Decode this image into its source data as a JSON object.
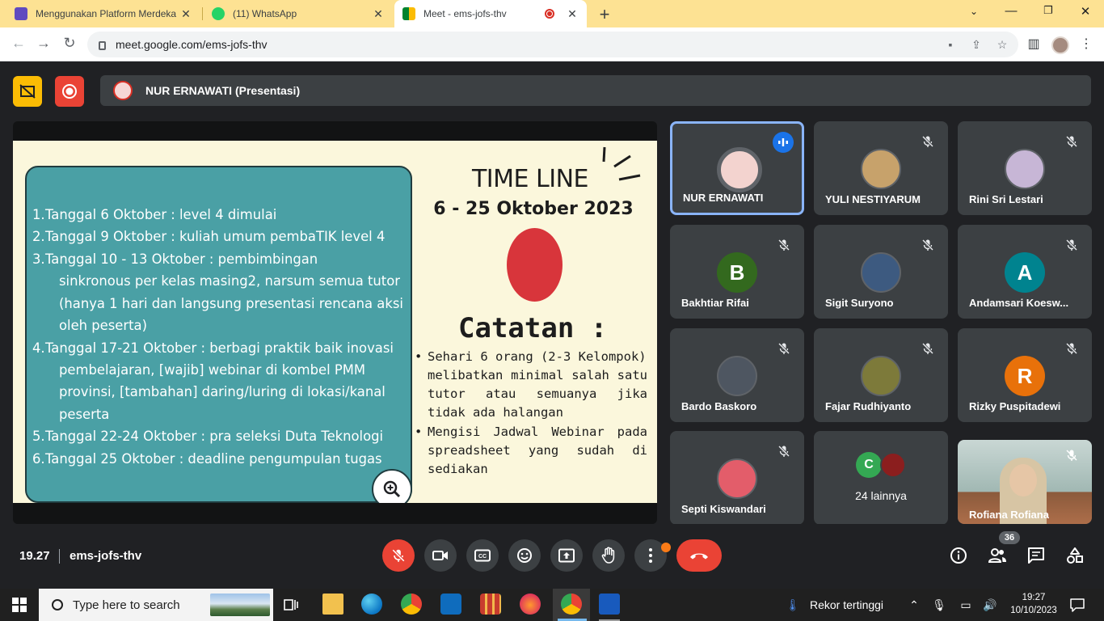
{
  "browser": {
    "tabs": [
      {
        "title": "Menggunakan Platform Merdeka",
        "favicon_color": "#5f4bbf"
      },
      {
        "title": "(11) WhatsApp",
        "favicon_color": "#25d366"
      },
      {
        "title": "Meet - ems-jofs-thv",
        "favicon_color": "#00897b"
      }
    ],
    "url": "meet.google.com/ems-jofs-thv"
  },
  "meet": {
    "presenter_label": "NUR ERNAWATI (Presentasi)",
    "slide": {
      "timeline": [
        {
          "num": "1.",
          "text": "Tanggal 6 Oktober  : level 4 dimulai"
        },
        {
          "num": "2.",
          "text": "Tanggal 9 Oktober : kuliah umum pembaTIK level 4"
        },
        {
          "num": "3.",
          "text": " Tanggal 10 - 13 Oktober  : pembimbingan"
        },
        {
          "num": "",
          "text": "sinkronous per kelas masing2, narsum semua tutor"
        },
        {
          "num": "",
          "text": "(hanya 1 hari dan langsung presentasi rencana aksi"
        },
        {
          "num": "",
          "text": "oleh peserta)"
        },
        {
          "num": "4.",
          "text": "Tanggal 17-21 Oktober  : berbagi praktik baik inovasi"
        },
        {
          "num": "",
          "text": "pembelajaran, [wajib] webinar di kombel PMM"
        },
        {
          "num": "",
          "text": "provinsi, [tambahan] daring/luring di lokasi/kanal"
        },
        {
          "num": "",
          "text": "peserta"
        },
        {
          "num": "5.",
          "text": "Tanggal 22-24 Oktober  : pra seleksi Duta Teknologi"
        },
        {
          "num": "6.",
          "text": "Tanggal 25 Oktober  : deadline pengumpulan tugas"
        }
      ],
      "title": "TIME LINE",
      "date_range": "6 - 25 Oktober 2023",
      "notes_heading": "Catatan :",
      "notes": [
        [
          "Sehari 6 orang (2-3 Kelompok)",
          "melibatkan minimal salah satu",
          "tutor atau semuanya jika",
          "tidak ada halangan"
        ],
        [
          "Mengisi Jadwal Webinar pada",
          "spreadsheet yang sudah di",
          "sediakan"
        ]
      ]
    },
    "participants": [
      {
        "name": "NUR ERNAWATI",
        "avatar": "photo",
        "color": "#f3d3cf",
        "speaking": true
      },
      {
        "name": "YULI NESTIYARUM",
        "avatar": "photo",
        "color": "#c7a26b"
      },
      {
        "name": "Rini Sri Lestari",
        "avatar": "photo",
        "color": "#c7b6d6"
      },
      {
        "name": "Bakhtiar Rifai",
        "avatar": "letter",
        "letter": "B",
        "color": "#33691e"
      },
      {
        "name": "Sigit Suryono",
        "avatar": "photo",
        "color": "#3d5a80"
      },
      {
        "name": "Andamsari Koesw...",
        "avatar": "letter",
        "letter": "A",
        "color": "#00838f"
      },
      {
        "name": "Bardo Baskoro",
        "avatar": "photo",
        "color": "#4e5661"
      },
      {
        "name": "Fajar Rudhiyanto",
        "avatar": "photo",
        "color": "#7d7a3a"
      },
      {
        "name": "Rizky Puspitadewi",
        "avatar": "letter",
        "letter": "R",
        "color": "#e8710a"
      },
      {
        "name": "Septi Kiswandari",
        "avatar": "photo",
        "color": "#e35d6a"
      }
    ],
    "others": {
      "label": "24 lainnya",
      "letter": "C",
      "color": "#34a853"
    },
    "video_tile_name": "Rofiana Rofiana",
    "clock": "19.27",
    "meeting_code": "ems-jofs-thv",
    "people_count": "36"
  },
  "taskbar": {
    "search_placeholder": "Type here to search",
    "weather": "Rekor tertinggi",
    "time": "19:27",
    "date": "10/10/2023"
  }
}
